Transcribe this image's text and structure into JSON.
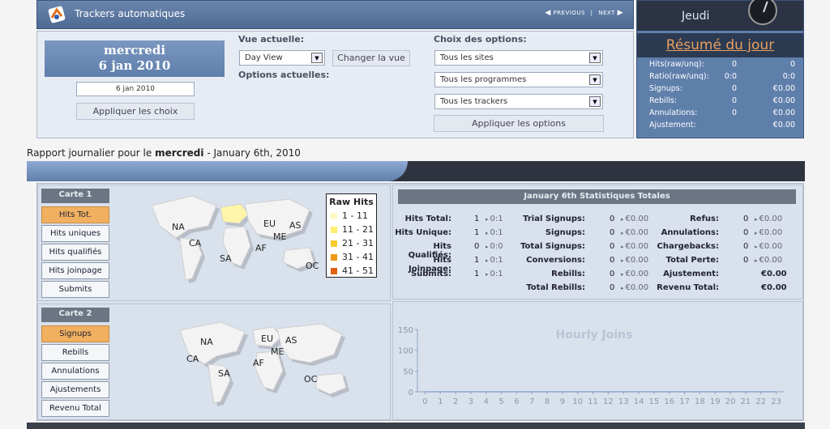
{
  "header": {
    "title": "Trackers automatiques",
    "previous": "PREVIOUS",
    "separator": "|",
    "next": "NEXT"
  },
  "options": {
    "date_day": "mercredi",
    "date_full": "6 jan 2010",
    "date_input": "6 jan 2010",
    "apply_choices": "Appliquer les choix",
    "vue_label": "Vue actuelle:",
    "view_select": "Day View",
    "change_view": "Changer la vue",
    "current_options_label": "Options actuelles:",
    "choice_label": "Choix des options:",
    "sites_select": "Tous les sites",
    "programs_select": "Tous les programmes",
    "trackers_select": "Tous les trackers",
    "apply_options": "Appliquer les options"
  },
  "summary": {
    "day": "Jeudi",
    "title": "Résumé du jour",
    "rows": [
      {
        "label": "Hits(raw/unq):",
        "a": "0",
        "b": "0"
      },
      {
        "label": "Ratio(raw/unq):",
        "a": "0:0",
        "b": "0:0"
      },
      {
        "label": "Signups:",
        "a": "0",
        "b": "€0.00"
      },
      {
        "label": "Rebills:",
        "a": "0",
        "b": "€0.00"
      },
      {
        "label": "Annulations:",
        "a": "0",
        "b": "€0.00"
      },
      {
        "label": "Ajustement:",
        "a": "",
        "b": "€0.00"
      }
    ]
  },
  "report": {
    "prefix": "Rapport journalier pour le ",
    "day": "mercredi",
    "suffix": " - January 6th, 2010"
  },
  "map1": {
    "title": "Carte 1",
    "buttons": [
      "Hits Tot.",
      "Hits uniques",
      "Hits qualifiés",
      "Hits joinpage",
      "Submits"
    ],
    "labels": {
      "na": "NA",
      "eu": "EU",
      "as": "AS",
      "me": "ME",
      "ca": "CA",
      "af": "AF",
      "sa": "SA",
      "oc": "OC"
    }
  },
  "map2": {
    "title": "Carte 2",
    "buttons": [
      "Signups",
      "Rebills",
      "Annulations",
      "Ajustements",
      "Revenu Total"
    ],
    "labels": {
      "na": "NA",
      "eu": "EU",
      "as": "AS",
      "me": "ME",
      "ca": "CA",
      "af": "AF",
      "sa": "SA",
      "oc": "OC"
    }
  },
  "legend": {
    "title": "Raw Hits",
    "items": [
      {
        "label": "1 - 11",
        "color": "#fff9c8"
      },
      {
        "label": "11 - 21",
        "color": "#ffee70"
      },
      {
        "label": "21 - 31",
        "color": "#f8cc30"
      },
      {
        "label": "31 - 41",
        "color": "#f09818"
      },
      {
        "label": "41 - 51",
        "color": "#e06010"
      }
    ]
  },
  "stats": {
    "title": "January 6th Statistiques Totales",
    "col1": [
      {
        "label": "Hits Total:",
        "value": "1",
        "delta": "0:1"
      },
      {
        "label": "Hits Unique:",
        "value": "1",
        "delta": "0:1"
      },
      {
        "label": "Hits Qualifiés:",
        "value": "0",
        "delta": "0:0"
      },
      {
        "label": "Hits Joinpage:",
        "value": "1",
        "delta": "0:1"
      },
      {
        "label": "Submits:",
        "value": "1",
        "delta": "0:1"
      }
    ],
    "col2": [
      {
        "label": "Trial Signups:",
        "value": "0",
        "delta": "€0.00"
      },
      {
        "label": "Signups:",
        "value": "0",
        "delta": "€0.00"
      },
      {
        "label": "Total Signups:",
        "value": "0",
        "delta": "€0.00"
      },
      {
        "label": "Conversions:",
        "value": "0",
        "delta": "€0.00"
      },
      {
        "label": "Rebills:",
        "value": "0",
        "delta": "€0.00"
      },
      {
        "label": "Total Rebills:",
        "value": "0",
        "delta": "€0.00"
      }
    ],
    "col3": [
      {
        "label": "Refus:",
        "value": "0",
        "delta": "€0.00"
      },
      {
        "label": "Annulations:",
        "value": "0",
        "delta": "€0.00"
      },
      {
        "label": "Chargebacks:",
        "value": "0",
        "delta": "€0.00"
      },
      {
        "label": "Total Perte:",
        "value": "0",
        "delta": "€0.00"
      },
      {
        "label": "Ajustement:",
        "value": "",
        "delta": "€0.00"
      },
      {
        "label": "Revenu Total:",
        "value": "",
        "delta": "€0.00"
      }
    ]
  },
  "chart_data": {
    "type": "line",
    "title": "Hourly Joins",
    "x": [
      0,
      1,
      2,
      3,
      4,
      5,
      6,
      7,
      8,
      9,
      10,
      11,
      12,
      13,
      14,
      15,
      16,
      17,
      18,
      19,
      20,
      21,
      22,
      23
    ],
    "series": [
      {
        "values": [
          0,
          0,
          0,
          0,
          0,
          0,
          0,
          0,
          0,
          0,
          0,
          0,
          0,
          0,
          0,
          0,
          0,
          0,
          0,
          0,
          0,
          0,
          0,
          0
        ]
      }
    ],
    "yticks": [
      0,
      50,
      100,
      150
    ],
    "ylim": [
      0,
      150
    ],
    "xlabel": "",
    "ylabel": "",
    "grid": false
  }
}
